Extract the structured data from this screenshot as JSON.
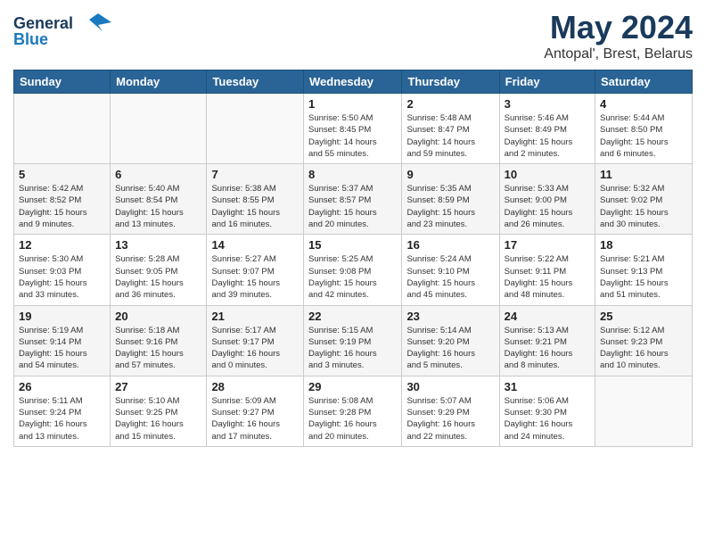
{
  "header": {
    "logo_line1": "General",
    "logo_line2": "Blue",
    "month_year": "May 2024",
    "location": "Antopal', Brest, Belarus"
  },
  "weekdays": [
    "Sunday",
    "Monday",
    "Tuesday",
    "Wednesday",
    "Thursday",
    "Friday",
    "Saturday"
  ],
  "weeks": [
    [
      {
        "day": "",
        "info": ""
      },
      {
        "day": "",
        "info": ""
      },
      {
        "day": "",
        "info": ""
      },
      {
        "day": "1",
        "info": "Sunrise: 5:50 AM\nSunset: 8:45 PM\nDaylight: 14 hours\nand 55 minutes."
      },
      {
        "day": "2",
        "info": "Sunrise: 5:48 AM\nSunset: 8:47 PM\nDaylight: 14 hours\nand 59 minutes."
      },
      {
        "day": "3",
        "info": "Sunrise: 5:46 AM\nSunset: 8:49 PM\nDaylight: 15 hours\nand 2 minutes."
      },
      {
        "day": "4",
        "info": "Sunrise: 5:44 AM\nSunset: 8:50 PM\nDaylight: 15 hours\nand 6 minutes."
      }
    ],
    [
      {
        "day": "5",
        "info": "Sunrise: 5:42 AM\nSunset: 8:52 PM\nDaylight: 15 hours\nand 9 minutes."
      },
      {
        "day": "6",
        "info": "Sunrise: 5:40 AM\nSunset: 8:54 PM\nDaylight: 15 hours\nand 13 minutes."
      },
      {
        "day": "7",
        "info": "Sunrise: 5:38 AM\nSunset: 8:55 PM\nDaylight: 15 hours\nand 16 minutes."
      },
      {
        "day": "8",
        "info": "Sunrise: 5:37 AM\nSunset: 8:57 PM\nDaylight: 15 hours\nand 20 minutes."
      },
      {
        "day": "9",
        "info": "Sunrise: 5:35 AM\nSunset: 8:59 PM\nDaylight: 15 hours\nand 23 minutes."
      },
      {
        "day": "10",
        "info": "Sunrise: 5:33 AM\nSunset: 9:00 PM\nDaylight: 15 hours\nand 26 minutes."
      },
      {
        "day": "11",
        "info": "Sunrise: 5:32 AM\nSunset: 9:02 PM\nDaylight: 15 hours\nand 30 minutes."
      }
    ],
    [
      {
        "day": "12",
        "info": "Sunrise: 5:30 AM\nSunset: 9:03 PM\nDaylight: 15 hours\nand 33 minutes."
      },
      {
        "day": "13",
        "info": "Sunrise: 5:28 AM\nSunset: 9:05 PM\nDaylight: 15 hours\nand 36 minutes."
      },
      {
        "day": "14",
        "info": "Sunrise: 5:27 AM\nSunset: 9:07 PM\nDaylight: 15 hours\nand 39 minutes."
      },
      {
        "day": "15",
        "info": "Sunrise: 5:25 AM\nSunset: 9:08 PM\nDaylight: 15 hours\nand 42 minutes."
      },
      {
        "day": "16",
        "info": "Sunrise: 5:24 AM\nSunset: 9:10 PM\nDaylight: 15 hours\nand 45 minutes."
      },
      {
        "day": "17",
        "info": "Sunrise: 5:22 AM\nSunset: 9:11 PM\nDaylight: 15 hours\nand 48 minutes."
      },
      {
        "day": "18",
        "info": "Sunrise: 5:21 AM\nSunset: 9:13 PM\nDaylight: 15 hours\nand 51 minutes."
      }
    ],
    [
      {
        "day": "19",
        "info": "Sunrise: 5:19 AM\nSunset: 9:14 PM\nDaylight: 15 hours\nand 54 minutes."
      },
      {
        "day": "20",
        "info": "Sunrise: 5:18 AM\nSunset: 9:16 PM\nDaylight: 15 hours\nand 57 minutes."
      },
      {
        "day": "21",
        "info": "Sunrise: 5:17 AM\nSunset: 9:17 PM\nDaylight: 16 hours\nand 0 minutes."
      },
      {
        "day": "22",
        "info": "Sunrise: 5:15 AM\nSunset: 9:19 PM\nDaylight: 16 hours\nand 3 minutes."
      },
      {
        "day": "23",
        "info": "Sunrise: 5:14 AM\nSunset: 9:20 PM\nDaylight: 16 hours\nand 5 minutes."
      },
      {
        "day": "24",
        "info": "Sunrise: 5:13 AM\nSunset: 9:21 PM\nDaylight: 16 hours\nand 8 minutes."
      },
      {
        "day": "25",
        "info": "Sunrise: 5:12 AM\nSunset: 9:23 PM\nDaylight: 16 hours\nand 10 minutes."
      }
    ],
    [
      {
        "day": "26",
        "info": "Sunrise: 5:11 AM\nSunset: 9:24 PM\nDaylight: 16 hours\nand 13 minutes."
      },
      {
        "day": "27",
        "info": "Sunrise: 5:10 AM\nSunset: 9:25 PM\nDaylight: 16 hours\nand 15 minutes."
      },
      {
        "day": "28",
        "info": "Sunrise: 5:09 AM\nSunset: 9:27 PM\nDaylight: 16 hours\nand 17 minutes."
      },
      {
        "day": "29",
        "info": "Sunrise: 5:08 AM\nSunset: 9:28 PM\nDaylight: 16 hours\nand 20 minutes."
      },
      {
        "day": "30",
        "info": "Sunrise: 5:07 AM\nSunset: 9:29 PM\nDaylight: 16 hours\nand 22 minutes."
      },
      {
        "day": "31",
        "info": "Sunrise: 5:06 AM\nSunset: 9:30 PM\nDaylight: 16 hours\nand 24 minutes."
      },
      {
        "day": "",
        "info": ""
      }
    ]
  ]
}
